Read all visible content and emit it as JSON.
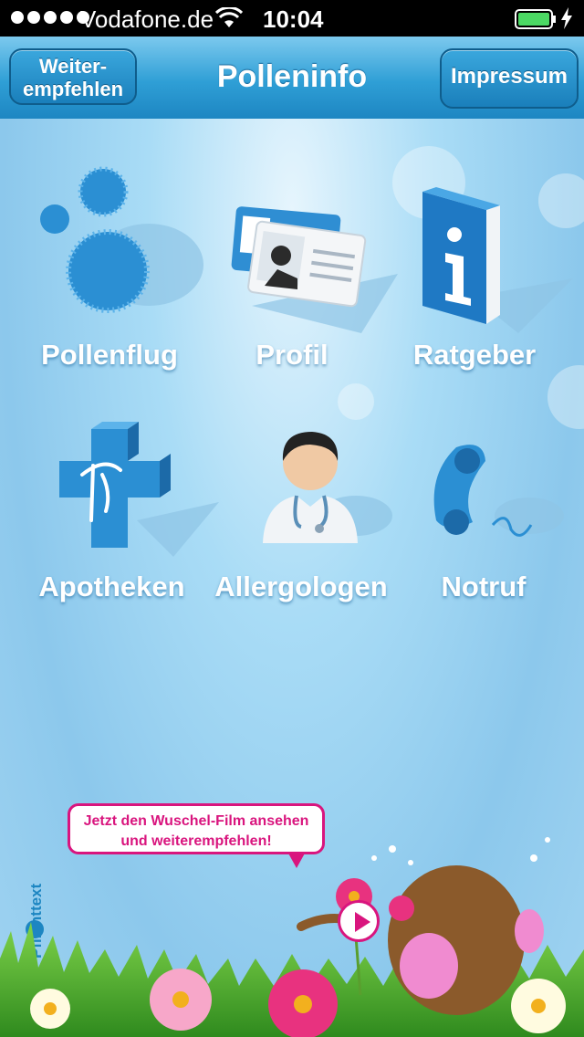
{
  "status": {
    "carrier": "Vodafone.de",
    "time": "10:04"
  },
  "nav": {
    "left_button": "Weiter-\nempfehlen",
    "title": "Polleninfo",
    "right_button": "Impressum"
  },
  "menu": [
    {
      "label": "Pollenflug",
      "icon": "pollen-icon"
    },
    {
      "label": "Profil",
      "icon": "id-card-icon"
    },
    {
      "label": "Ratgeber",
      "icon": "info-book-icon"
    },
    {
      "label": "Apotheken",
      "icon": "pharmacy-cross-icon"
    },
    {
      "label": "Allergologen",
      "icon": "doctor-icon"
    },
    {
      "label": "Notruf",
      "icon": "phone-icon"
    }
  ],
  "promo": {
    "side_label": "Pflichttext",
    "bubble_text": "Jetzt den Wuschel-Film ansehen und weiterempfehlen!"
  },
  "colors": {
    "accent": "#1d86c2",
    "promo": "#d9157e"
  }
}
